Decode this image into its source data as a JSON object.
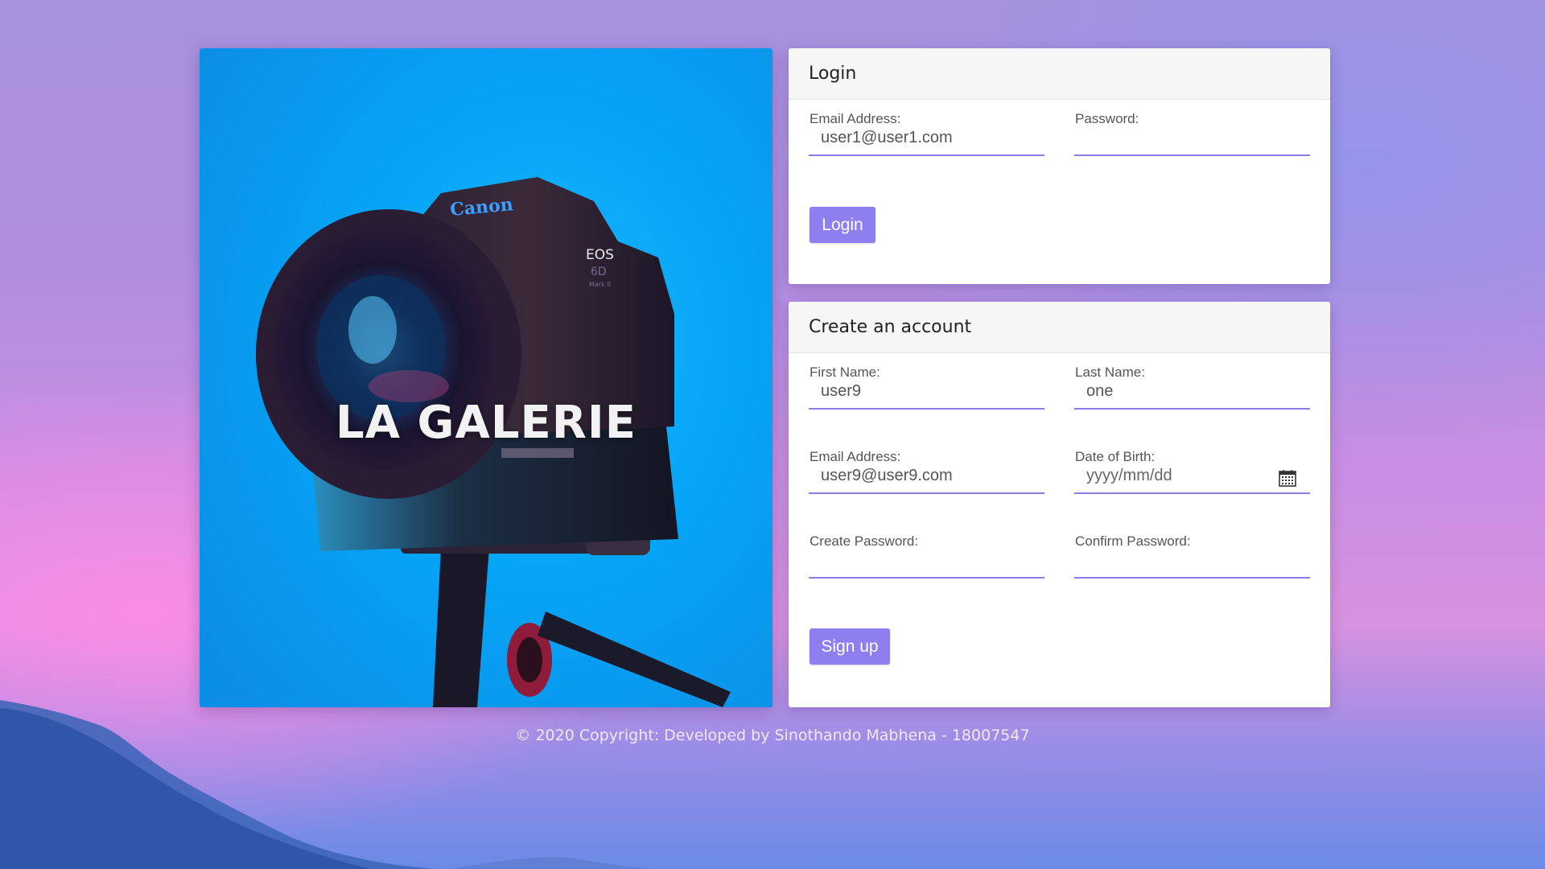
{
  "hero": {
    "title": "LA GALERIE",
    "camera_brand": "Canon",
    "camera_model": "EOS",
    "camera_submodel": "6D",
    "camera_mark": "Mark II"
  },
  "login": {
    "header": "Login",
    "email_label": "Email Address:",
    "email_value": "user1@user1.com",
    "password_label": "Password:",
    "password_value": "",
    "button_label": "Login"
  },
  "signup": {
    "header": "Create an account",
    "first_name_label": "First Name:",
    "first_name_value": "user9",
    "last_name_label": "Last Name:",
    "last_name_value": "one",
    "email_label": "Email Address:",
    "email_value": "user9@user9.com",
    "dob_label": "Date of Birth:",
    "dob_placeholder": "yyyy/mm/dd",
    "create_password_label": "Create Password:",
    "confirm_password_label": "Confirm Password:",
    "button_label": "Sign up"
  },
  "footer": {
    "text": "© 2020 Copyright: Developed by Sinothando Mabhena - 18007547"
  },
  "colors": {
    "accent": "#8e7ff0",
    "underline": "#8c7ae6",
    "hero_bg": "#06a5f6"
  }
}
